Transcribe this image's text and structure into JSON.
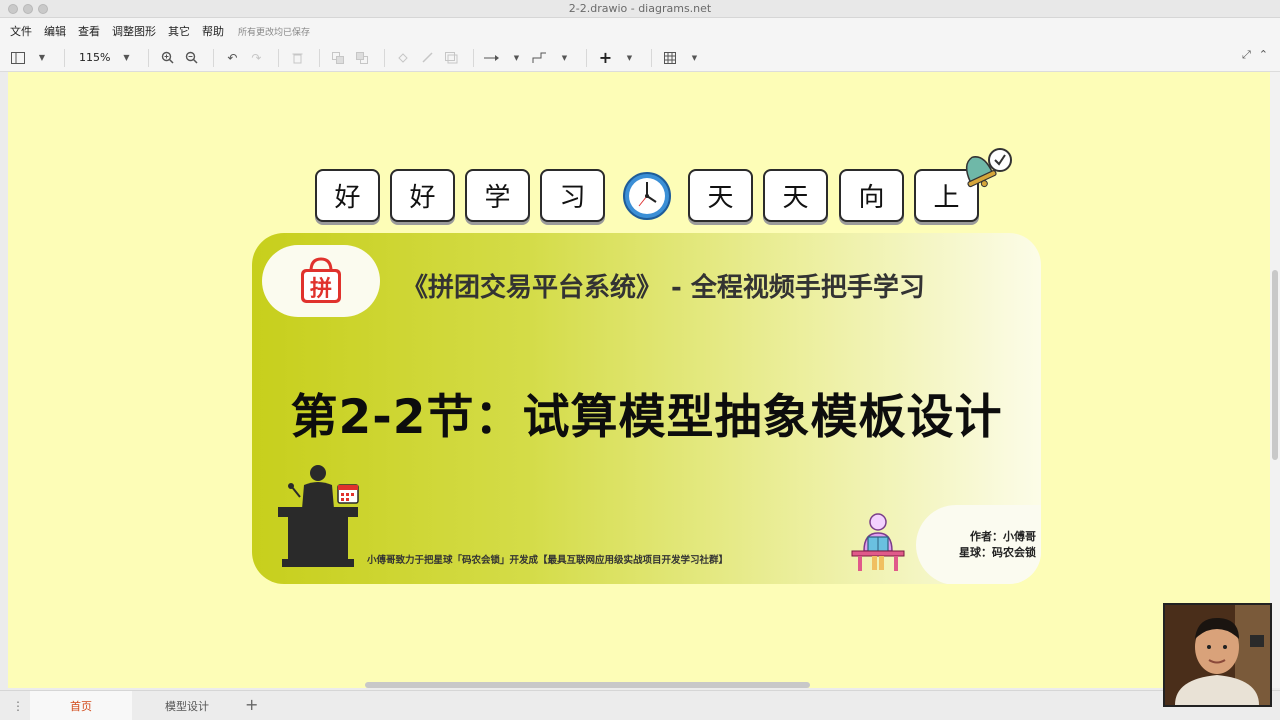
{
  "window": {
    "title": "2-2.drawio - diagrams.net"
  },
  "menu": {
    "items": [
      "文件",
      "编辑",
      "查看",
      "调整图形",
      "其它",
      "帮助"
    ],
    "save_status": "所有更改均已保存"
  },
  "toolbar": {
    "zoom_level": "115%",
    "icons": [
      "format-panel-icon",
      "zoom-in-icon",
      "zoom-out-icon",
      "undo-icon",
      "redo-icon",
      "delete-icon",
      "to-front-icon",
      "to-back-icon",
      "fill-color-icon",
      "line-color-icon",
      "shadow-icon",
      "connection-icon",
      "waypoints-icon",
      "insert-icon",
      "table-icon"
    ]
  },
  "slide": {
    "tiles": [
      "好",
      "好",
      "学",
      "习",
      "天",
      "天",
      "向",
      "上"
    ],
    "subtitle": "《拼团交易平台系统》 - 全程视频手把手学习",
    "logo_char": "拼",
    "main_title": "第2-2节：试算模型抽象模板设计",
    "slogan": "小傅哥致力于把星球「码农会锁」开发成【最具互联网应用级实战项目开发学习社群】",
    "author_line1": "作者：小傅哥",
    "author_line2": "星球：码农会锁",
    "colors": {
      "canvas_bg": "#fdfdb7",
      "banner_start": "#c7cf1c",
      "banner_end": "#fcfce8",
      "logo_red": "#e0322d",
      "clock_blue": "#3b8fd6"
    }
  },
  "tabs": {
    "items": [
      "首页",
      "模型设计"
    ],
    "active": "首页"
  }
}
